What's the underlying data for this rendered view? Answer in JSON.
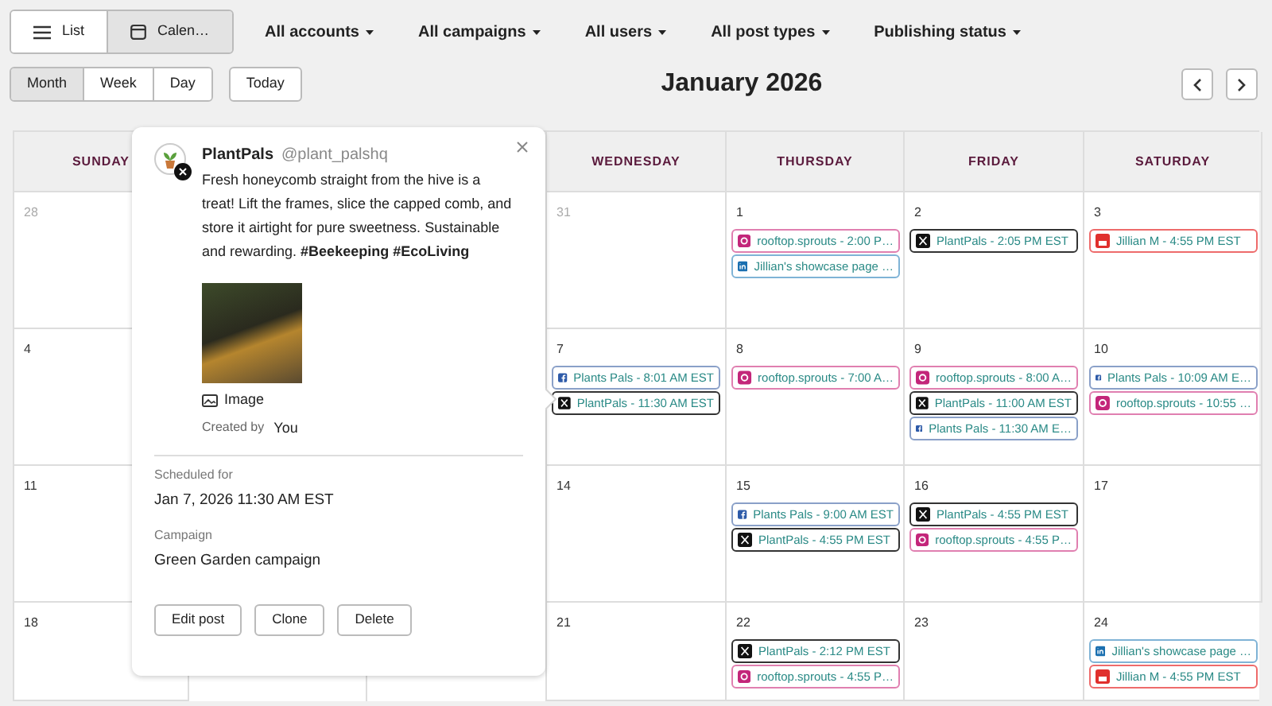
{
  "view_toggle": [
    {
      "label": "List",
      "kind": "list",
      "selected": false
    },
    {
      "label": "Calen…",
      "kind": "calendar",
      "selected": true
    }
  ],
  "filters": [
    "All accounts",
    "All campaigns",
    "All users",
    "All post types",
    "Publishing status"
  ],
  "range_tabs": [
    {
      "label": "Month",
      "selected": true
    },
    {
      "label": "Week",
      "selected": false
    },
    {
      "label": "Day",
      "selected": false
    }
  ],
  "today_button": "Today",
  "title": "January 2026",
  "calendar": {
    "headers": [
      {
        "label": "SUNDAY"
      },
      {
        "label": "WEDNESDAY"
      },
      {
        "label": "THURSDAY"
      },
      {
        "label": "FRIDAY"
      },
      {
        "label": "SATURDAY"
      }
    ],
    "weeks": [
      {
        "cells": [
          {
            "day": "28",
            "muted": true
          },
          {
            "day": "31",
            "muted": true
          },
          {
            "day": "1",
            "muted": false,
            "posts": [
              {
                "kind": "instagram",
                "text": "rooftop.sprouts - 2:00 P…"
              },
              {
                "kind": "linkedin",
                "text": "Jillian's showcase page …"
              }
            ]
          },
          {
            "day": "2",
            "muted": false,
            "posts": [
              {
                "kind": "x",
                "text": "PlantPals - 2:05 PM EST"
              }
            ]
          },
          {
            "day": "3",
            "muted": false,
            "posts": [
              {
                "kind": "youtube",
                "text": "Jillian M - 4:55 PM EST"
              }
            ]
          }
        ]
      },
      {
        "cells": [
          {
            "day": "4",
            "muted": false
          },
          {
            "day": "7",
            "muted": false,
            "posts": [
              {
                "kind": "facebook",
                "text": "Plants Pals - 8:01 AM EST"
              },
              {
                "kind": "x",
                "text": "PlantPals - 11:30 AM EST"
              }
            ]
          },
          {
            "day": "8",
            "muted": false,
            "posts": [
              {
                "kind": "instagram",
                "text": "rooftop.sprouts - 7:00 A…"
              }
            ]
          },
          {
            "day": "9",
            "muted": false,
            "posts": [
              {
                "kind": "instagram",
                "text": "rooftop.sprouts - 8:00 A…"
              },
              {
                "kind": "x",
                "text": "PlantPals - 11:00 AM EST"
              },
              {
                "kind": "facebook",
                "text": "Plants Pals - 11:30 AM E…"
              }
            ]
          },
          {
            "day": "10",
            "muted": false,
            "posts": [
              {
                "kind": "facebook",
                "text": "Plants Pals - 10:09 AM E…"
              },
              {
                "kind": "instagram",
                "text": "rooftop.sprouts - 10:55 …"
              }
            ]
          }
        ]
      },
      {
        "cells": [
          {
            "day": "11",
            "muted": false
          },
          {
            "day": "14",
            "muted": false
          },
          {
            "day": "15",
            "muted": false,
            "posts": [
              {
                "kind": "facebook",
                "text": "Plants Pals - 9:00 AM EST"
              },
              {
                "kind": "x",
                "text": "PlantPals - 4:55 PM EST"
              }
            ]
          },
          {
            "day": "16",
            "muted": false,
            "posts": [
              {
                "kind": "x",
                "text": "PlantPals - 4:55 PM EST"
              },
              {
                "kind": "instagram",
                "text": "rooftop.sprouts - 4:55 P…"
              }
            ]
          },
          {
            "day": "17",
            "muted": false
          }
        ]
      },
      {
        "cells": [
          {
            "day": "18",
            "muted": false
          },
          {
            "day": "21",
            "muted": false
          },
          {
            "day": "22",
            "muted": false,
            "posts": [
              {
                "kind": "x",
                "text": "PlantPals - 2:12 PM EST"
              },
              {
                "kind": "instagram",
                "text": "rooftop.sprouts - 4:55 P…"
              }
            ]
          },
          {
            "day": "23",
            "muted": false
          },
          {
            "day": "24",
            "muted": false,
            "posts": [
              {
                "kind": "linkedin",
                "text": "Jillian's showcase page …"
              },
              {
                "kind": "youtube",
                "text": "Jillian M - 4:55 PM EST"
              }
            ]
          }
        ]
      }
    ]
  },
  "popover": {
    "name": "PlantPals",
    "handle": "@plant_palshq",
    "body": "Fresh honeycomb straight from the hive is a treat! Lift the frames, slice the capped comb, and store it airtight for pure sweetness. Sustainable and rewarding. **#Beekeeping #EcoLiving**",
    "media_label": "Image",
    "created_by_label": "Created by",
    "created_by": "You",
    "scheduled_label": "Scheduled for",
    "scheduled": "Jan 7, 2026 11:30 AM EST",
    "campaign_label": "Campaign",
    "campaign": "Green Garden campaign",
    "actions": [
      "Edit post",
      "Clone",
      "Delete"
    ]
  }
}
